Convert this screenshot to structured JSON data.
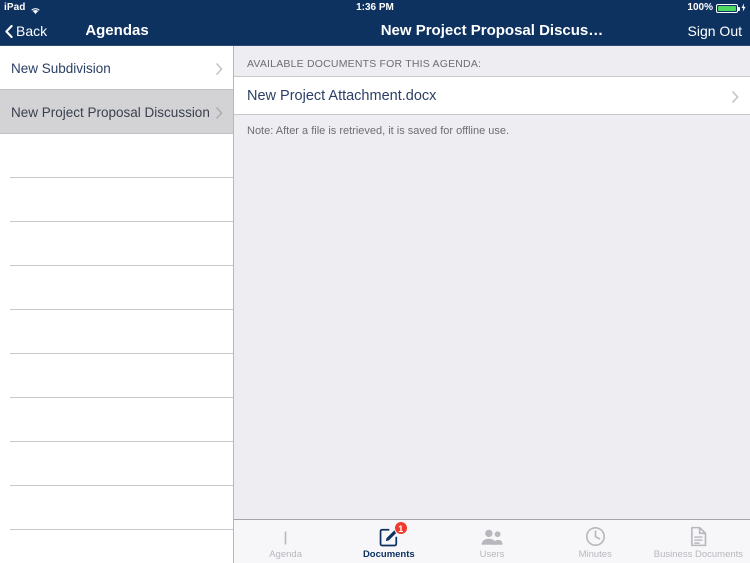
{
  "status_bar": {
    "device": "iPad",
    "wifi_icon": "wifi-icon",
    "time": "1:36 PM",
    "battery_percent": "100%",
    "battery_icon": "battery-icon",
    "charging_icon": "lightning-bolt-icon"
  },
  "master_nav": {
    "back_label": "Back",
    "back_icon": "chevron-left-icon",
    "title": "Agendas"
  },
  "detail_nav": {
    "title": "New Project Proposal Discus…",
    "sign_out_label": "Sign Out"
  },
  "agendas": {
    "items": [
      {
        "label": "New Subdivision",
        "selected": false,
        "chevron": "chevron-right-icon"
      },
      {
        "label": "New Project Proposal Discussion",
        "selected": true,
        "chevron": "chevron-right-icon"
      }
    ],
    "empty_row_count": 9
  },
  "detail": {
    "section_header": "AVAILABLE DOCUMENTS FOR THIS AGENDA:",
    "documents": [
      {
        "name": "New Project Attachment.docx",
        "chevron": "chevron-right-icon"
      }
    ],
    "note": "Note: After a file is retrieved, it is saved for offline use."
  },
  "tab_bar": {
    "tabs": [
      {
        "label": "Agenda",
        "icon": "book-icon",
        "active": false,
        "badge": ""
      },
      {
        "label": "Documents",
        "icon": "compose-document-icon",
        "active": true,
        "badge": "1"
      },
      {
        "label": "Users",
        "icon": "users-icon",
        "active": false,
        "badge": ""
      },
      {
        "label": "Minutes",
        "icon": "clock-icon",
        "active": false,
        "badge": ""
      },
      {
        "label": "Business Documents",
        "icon": "document-icon",
        "active": false,
        "badge": ""
      }
    ]
  },
  "colors": {
    "navy": "#0d3260",
    "badge_red": "#ef3b2d",
    "battery_green": "#4cd964",
    "detail_bg": "#eeeef2",
    "selected_row": "#d3d3d6"
  }
}
